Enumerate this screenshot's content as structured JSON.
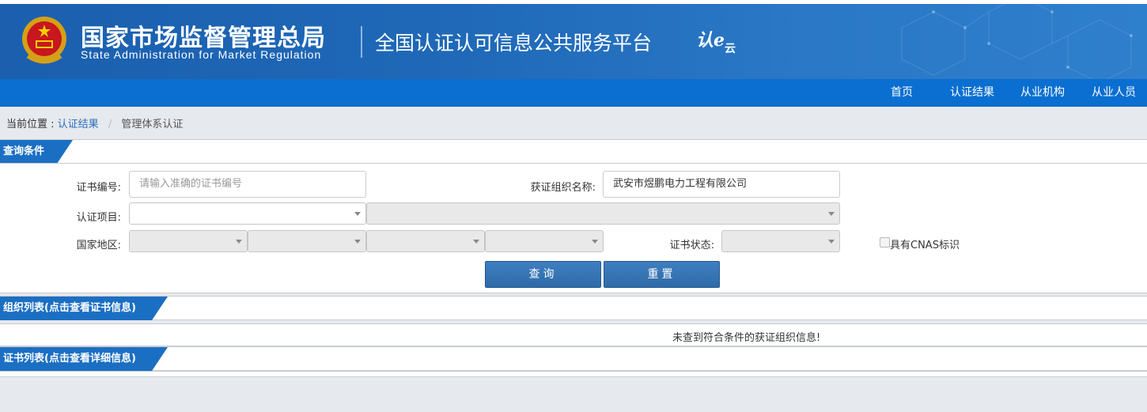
{
  "header": {
    "title_cn": "国家市场监督管理总局",
    "title_en": "State Administration  for  Market Regulation",
    "platform": "全国认证认可信息公共服务平台",
    "cloud_logo_main": "认e",
    "cloud_logo_sub": "云"
  },
  "nav": {
    "items": [
      "首页",
      "认证结果",
      "从业机构",
      "从业人员"
    ]
  },
  "breadcrumb": {
    "prefix": "当前位置 :",
    "link": "认证结果",
    "separator": "/",
    "current": "管理体系认证"
  },
  "query": {
    "section_title": "查询条件",
    "cert_no_label": "证书编号:",
    "cert_no_placeholder": "请输入准确的证书编号",
    "org_name_label": "获证组织名称:",
    "org_name_value": "武安市煜鹏电力工程有限公司",
    "project_label": "认证项目:",
    "region_label": "国家地区:",
    "status_label": "证书状态:",
    "cnas_label": "具有CNAS标识",
    "search_button": "查询",
    "reset_button": "重置"
  },
  "org_list": {
    "section_title": "组织列表(点击查看证书信息)",
    "empty_message": "未查到符合条件的获证组织信息!"
  },
  "cert_list": {
    "section_title": "证书列表(点击查看详细信息)"
  },
  "colors": {
    "banner": "#1f69b8",
    "navbar": "#0a6fd1",
    "section_tab": "#1b6fc3",
    "button": "#3572b2"
  }
}
